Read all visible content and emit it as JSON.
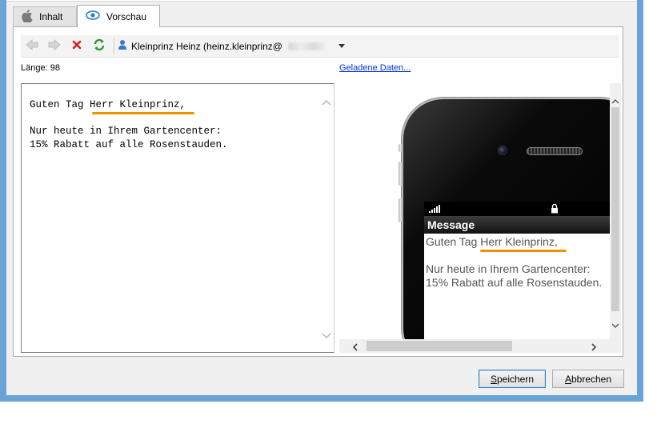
{
  "tabs": [
    {
      "label": "Inhalt",
      "icon": "apple-icon",
      "active": false
    },
    {
      "label": "Vorschau",
      "icon": "eye-icon",
      "active": true
    }
  ],
  "toolbar": {
    "back_icon": "arrow-left-icon",
    "forward_icon": "arrow-right-icon",
    "delete_icon": "red-x-icon",
    "refresh_icon": "green-refresh-icon",
    "recipient_icon": "person-icon",
    "recipient_label": "Kleinprinz Heinz (heinz.kleinprinz@"
  },
  "length": {
    "label": "Länge: 98"
  },
  "loaded_data_link": "Geladene Daten...",
  "preview_text": {
    "greeting_prefix": "Guten Tag ",
    "greeting_name": "Herr Kleinprinz,",
    "line3": "Nur heute in Ihrem Gartencenter:",
    "line4": "15% Rabatt auf alle Rosenstauden."
  },
  "phone": {
    "header": "Message",
    "greeting_prefix": "Guten Tag ",
    "greeting_name": "Herr Kleinprinz,",
    "line3": "Nur heute in Ihrem Gartencenter:",
    "line4": "15% Rabatt auf alle Rosenstauden."
  },
  "buttons": {
    "save_accel": "S",
    "save_rest": "peichern",
    "cancel_accel": "A",
    "cancel_rest": "bbrechen"
  },
  "colors": {
    "highlight_underline": "#f29100",
    "window_frame": "#6aa3d6",
    "link": "#0033cc"
  }
}
